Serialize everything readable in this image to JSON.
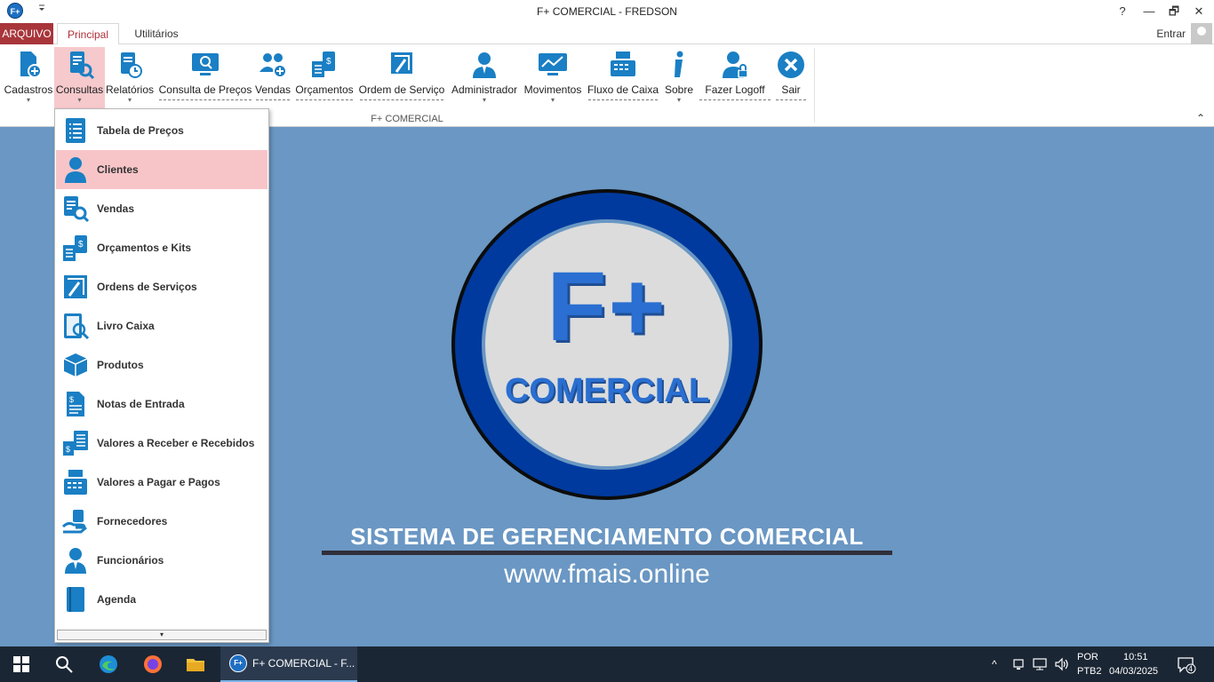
{
  "window": {
    "title": "F+ COMERCIAL - FREDSON",
    "app_icon": "F+",
    "qat_icon": "quick-access-toolbar-icon",
    "help": "?",
    "minimize": "—",
    "restore": "🗗",
    "close": "✕"
  },
  "ribbon": {
    "tabs": {
      "arquivo": "ARQUIVO",
      "principal": "Principal",
      "utilitarios": "Utilitários"
    },
    "entrar": "Entrar",
    "group_label": "F+ COMERCIAL",
    "collapse_icon": "⌃",
    "buttons": [
      {
        "label": "Cadastros",
        "icon": "cadastros-icon"
      },
      {
        "label": "Consultas",
        "icon": "consultas-icon"
      },
      {
        "label": "Relatórios",
        "icon": "relatorios-icon"
      },
      {
        "label": "Consulta de Preços",
        "icon": "consulta-precos-icon"
      },
      {
        "label": "Vendas",
        "icon": "vendas-icon"
      },
      {
        "label": "Orçamentos",
        "icon": "orcamentos-icon"
      },
      {
        "label": "Ordem de Serviço",
        "icon": "ordem-servico-icon"
      },
      {
        "label": "Administrador",
        "icon": "administrador-icon"
      },
      {
        "label": "Movimentos",
        "icon": "movimentos-icon"
      },
      {
        "label": "Fluxo de Caixa",
        "icon": "fluxo-caixa-icon"
      },
      {
        "label": "Sobre",
        "icon": "sobre-icon"
      },
      {
        "label": "Fazer Logoff",
        "icon": "logoff-icon"
      },
      {
        "label": "Sair",
        "icon": "sair-icon"
      }
    ]
  },
  "dropdown": {
    "items": [
      {
        "label": "Tabela de Preços",
        "icon": "price-table-icon"
      },
      {
        "label": "Clientes",
        "icon": "client-icon"
      },
      {
        "label": "Vendas",
        "icon": "sales-search-icon"
      },
      {
        "label": "Orçamentos e Kits",
        "icon": "budget-icon"
      },
      {
        "label": "Ordens de Serviços",
        "icon": "service-order-icon"
      },
      {
        "label": "Livro Caixa",
        "icon": "cash-book-icon"
      },
      {
        "label": "Produtos",
        "icon": "product-box-icon"
      },
      {
        "label": "Notas de Entrada",
        "icon": "invoice-icon"
      },
      {
        "label": "Valores a Receber e Recebidos",
        "icon": "receivables-icon"
      },
      {
        "label": "Valores a Pagar e Pagos",
        "icon": "payables-icon"
      },
      {
        "label": "Fornecedores",
        "icon": "supplier-icon"
      },
      {
        "label": "Funcionários",
        "icon": "employee-icon"
      },
      {
        "label": "Agenda",
        "icon": "agenda-icon"
      }
    ],
    "scroll_down": "▾"
  },
  "splash": {
    "logo_top": "F+",
    "logo_bottom": "COMERCIAL",
    "slogan": "SISTEMA DE GERENCIAMENTO COMERCIAL",
    "website": "www.fmais.online"
  },
  "taskbar": {
    "app_label": "F+ COMERCIAL - F...",
    "app_icon": "F+",
    "lang_top": "POR",
    "lang_bottom": "PTB2",
    "time": "10:51",
    "date": "04/03/2025",
    "notifications": "4",
    "colors": {
      "bg": "#1b2634",
      "accent": "#7ab4ea"
    }
  },
  "colors": {
    "accent_red": "#a8353a",
    "hover_pink": "#f7c5c8",
    "icon_blue": "#1a7fc4",
    "workspace": "#6a97c3"
  }
}
